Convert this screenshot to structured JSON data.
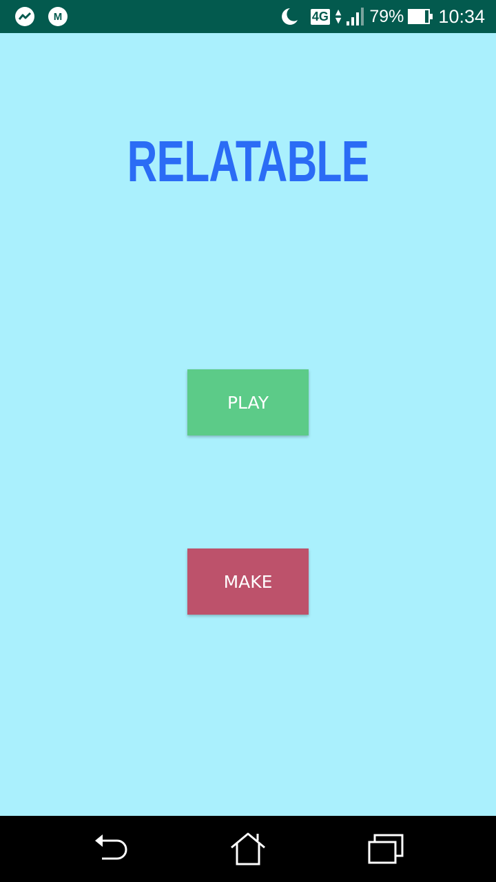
{
  "status_bar": {
    "notification_icons": [
      "messenger-icon",
      "gmail-icon"
    ],
    "network_type": "4G",
    "battery_percent": "79%",
    "battery_level": 0.79,
    "time": "10:34",
    "background_color": "#035a4e"
  },
  "app": {
    "title": "RELATABLE",
    "title_color": "#2b6cf5",
    "background_color": "#aaf0fd"
  },
  "buttons": {
    "play_label": "PLAY",
    "make_label": "MAKE",
    "play_color": "#5ccb88",
    "make_color": "#bd526b"
  },
  "nav_bar": {
    "icons": [
      "back-icon",
      "home-icon",
      "recents-icon"
    ]
  }
}
